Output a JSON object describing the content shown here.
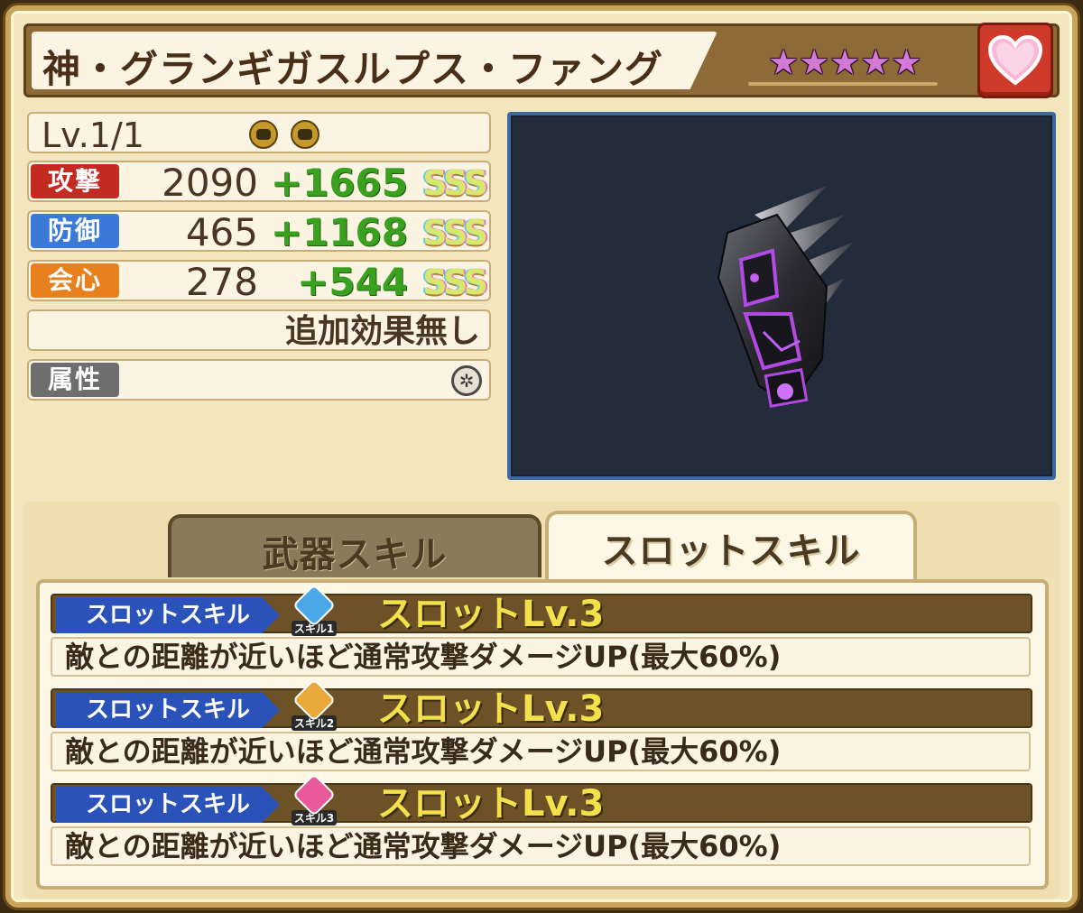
{
  "title": "神・グランギガスルプス・ファング",
  "rarity": {
    "stars": 5,
    "star_glyph": "★",
    "color": "#d27ad6"
  },
  "favorite_icon": "heart-icon",
  "level": "Lv.1/1",
  "level_icons": [
    "fist-icon",
    "fist-icon"
  ],
  "stats": [
    {
      "label": "攻撃",
      "base": "2090",
      "bonus": "+1665",
      "rank": "SSS",
      "color": "#c22a22"
    },
    {
      "label": "防御",
      "base": "465",
      "bonus": "+1168",
      "rank": "SSS",
      "color": "#3a7ad6"
    },
    {
      "label": "会心",
      "base": "278",
      "bonus": "+544",
      "rank": "SSS",
      "color": "#e9801e"
    }
  ],
  "extra_effect": "追加効果無し",
  "attribute": {
    "label": "属性",
    "icon": "neutral-element-icon"
  },
  "tabs": [
    {
      "label": "武器スキル",
      "active": false
    },
    {
      "label": "スロットスキル",
      "active": true
    }
  ],
  "slot_skills": [
    {
      "tag": "スロットスキル",
      "emblem": "スキル1",
      "emblem_color": "#4aa8e8",
      "level": "スロットLv.3",
      "description": "敵との距離が近いほど通常攻撃ダメージUP(最大60%)"
    },
    {
      "tag": "スロットスキル",
      "emblem": "スキル2",
      "emblem_color": "#e8a83a",
      "level": "スロットLv.3",
      "description": "敵との距離が近いほど通常攻撃ダメージUP(最大60%)"
    },
    {
      "tag": "スロットスキル",
      "emblem": "スキル3",
      "emblem_color": "#e85a9a",
      "level": "スロットLv.3",
      "description": "敵との距離が近いほど通常攻撃ダメージUP(最大60%)"
    }
  ]
}
